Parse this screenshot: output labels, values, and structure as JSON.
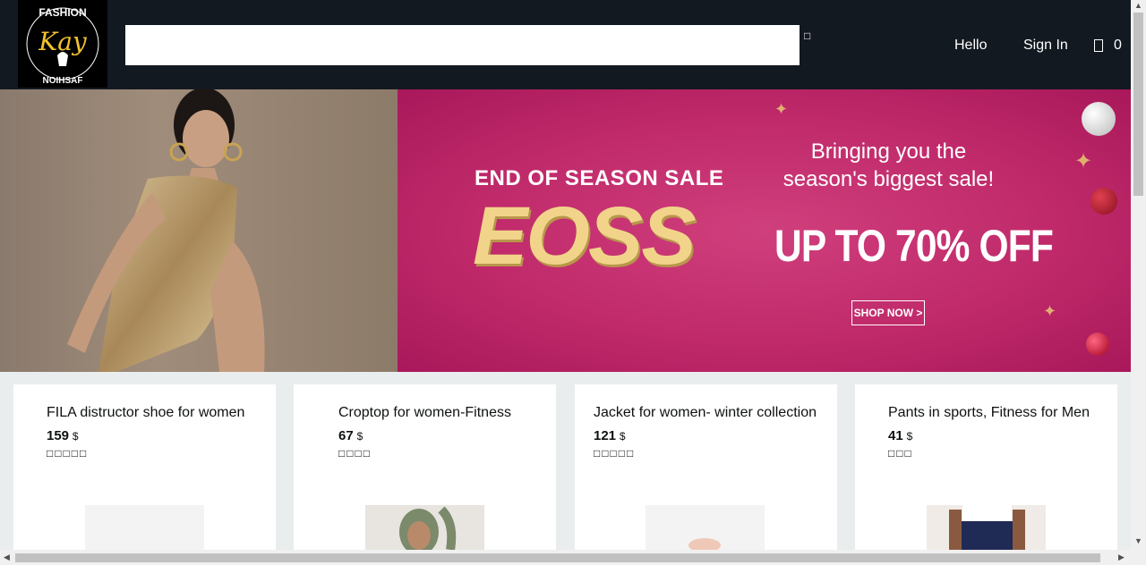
{
  "header": {
    "logo_text": "FASHION · FASHION · FASHION · Kay",
    "search": {
      "value": "",
      "placeholder": ""
    },
    "search_icon": "search-icon",
    "hello_label": "Hello",
    "signin_label": "Sign In",
    "cart_count": "0"
  },
  "banner": {
    "eyebrow": "END OF SEASON SALE",
    "brand": "EOSS",
    "tagline": "Bringing you the season's biggest sale!",
    "offer": "UP TO 70% OFF",
    "cta_label": "SHOP NOW >"
  },
  "products": [
    {
      "title": "FILA distructor shoe for women",
      "price": "159",
      "currency": "$",
      "stars": "□□□□□"
    },
    {
      "title": "Croptop for women-Fitness",
      "price": "67",
      "currency": "$",
      "stars": "□□□□"
    },
    {
      "title": "Jacket for women- winter collection",
      "price": "121",
      "currency": "$",
      "stars": "□□□□□"
    },
    {
      "title": "Pants in sports, Fitness for Men",
      "price": "41",
      "currency": "$",
      "stars": "□□□"
    }
  ],
  "colors": {
    "header_bg": "#131921",
    "banner_pink": "#c02a6a",
    "gold": "#f1d48a"
  }
}
